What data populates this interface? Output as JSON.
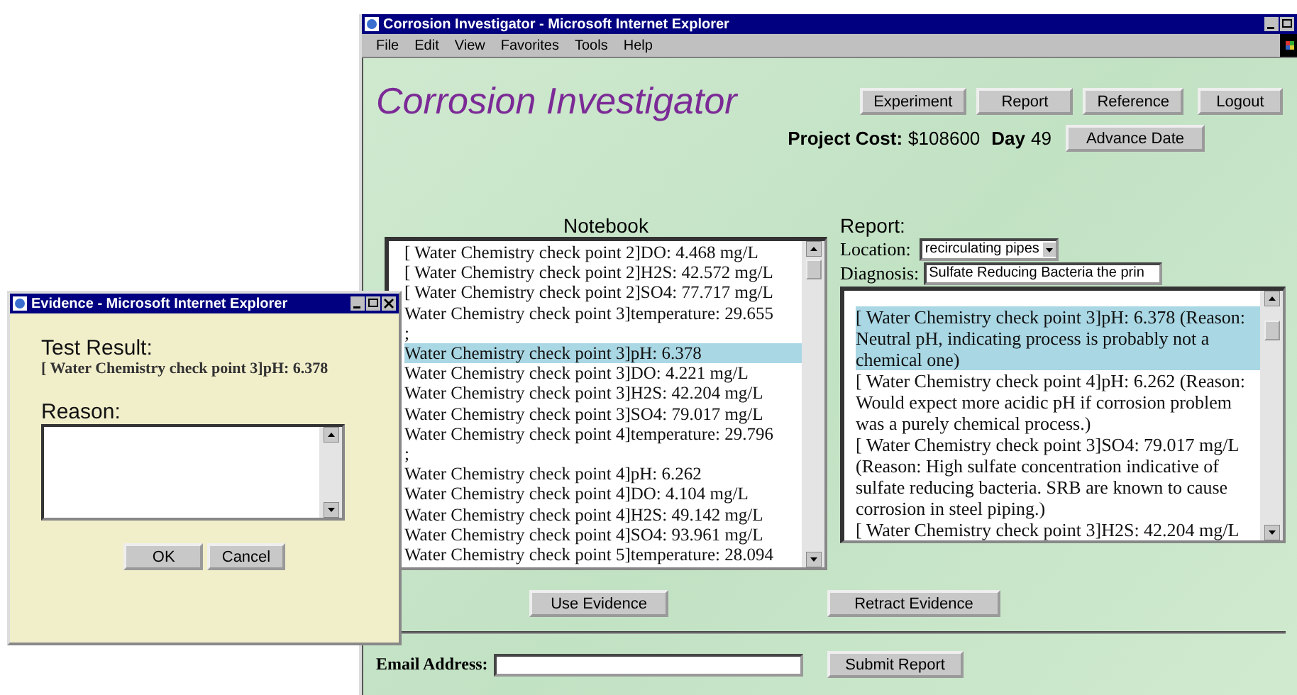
{
  "browser": {
    "title": "Corrosion Investigator - Microsoft Internet Explorer",
    "menu": [
      "File",
      "Edit",
      "View",
      "Favorites",
      "Tools",
      "Help"
    ]
  },
  "app_title": "Corrosion Investigator",
  "nav_buttons": [
    "Experiment",
    "Report",
    "Reference",
    "Logout"
  ],
  "project": {
    "cost_label": "Project Cost:",
    "cost": "$108600",
    "day_label": "Day",
    "day": "49",
    "advance_button": "Advance Date"
  },
  "notebook": {
    "title": "Notebook",
    "entries": [
      {
        "text": "[ Water Chemistry check point 2]DO: 4.468 mg/L",
        "selected": false
      },
      {
        "text": "[ Water Chemistry check point 2]H2S: 42.572 mg/L",
        "selected": false
      },
      {
        "text": "[ Water Chemistry check point 2]SO4: 77.717 mg/L",
        "selected": false
      },
      {
        "text": "Water Chemistry check point 3]temperature: 29.655",
        "selected": false
      },
      {
        "text": ";",
        "selected": false
      },
      {
        "text": "Water Chemistry check point 3]pH: 6.378",
        "selected": true
      },
      {
        "text": "Water Chemistry check point 3]DO: 4.221 mg/L",
        "selected": false
      },
      {
        "text": "Water Chemistry check point 3]H2S: 42.204 mg/L",
        "selected": false
      },
      {
        "text": "Water Chemistry check point 3]SO4: 79.017 mg/L",
        "selected": false
      },
      {
        "text": "Water Chemistry check point 4]temperature: 29.796",
        "selected": false
      },
      {
        "text": ";",
        "selected": false
      },
      {
        "text": "Water Chemistry check point 4]pH: 6.262",
        "selected": false
      },
      {
        "text": "Water Chemistry check point 4]DO: 4.104 mg/L",
        "selected": false
      },
      {
        "text": "Water Chemistry check point 4]H2S: 49.142 mg/L",
        "selected": false
      },
      {
        "text": "Water Chemistry check point 4]SO4: 93.961 mg/L",
        "selected": false
      },
      {
        "text": "Water Chemistry check point 5]temperature: 28.094",
        "selected": false
      }
    ]
  },
  "report": {
    "title": "Report:",
    "location_label": "Location:",
    "location": "recirculating pipes",
    "diagnosis_label": "Diagnosis:",
    "diagnosis": "Sulfate Reducing Bacteria the prin",
    "evidence": [
      {
        "text": "[ Water Chemistry check point 3]pH: 6.378 (Reason: Neutral pH, indicating process is probably not a chemical one)",
        "selected": true
      },
      {
        "text": "[ Water Chemistry check point 4]pH: 6.262 (Reason: Would expect more acidic pH if corrosion problem was a purely chemical process.)",
        "selected": false
      },
      {
        "text": "[ Water Chemistry check point 3]SO4: 79.017 mg/L (Reason: High sulfate concentration indicative of sulfate reducing bacteria. SRB are known to cause corrosion in steel piping.)",
        "selected": false
      },
      {
        "text": "[ Water Chemistry check point 3]H2S: 42.204 mg/L",
        "selected": false
      }
    ]
  },
  "actions": [
    "Use Evidence",
    "Retract Evidence"
  ],
  "email": {
    "label": "Email Address:",
    "submit": "Submit Report"
  },
  "dialog": {
    "title": "Evidence - Microsoft Internet Explorer",
    "test_result_label": "Test Result:",
    "test_result": "[ Water Chemistry check point 3]pH: 6.378",
    "reason_label": "Reason:",
    "buttons": [
      "OK",
      "Cancel"
    ]
  }
}
